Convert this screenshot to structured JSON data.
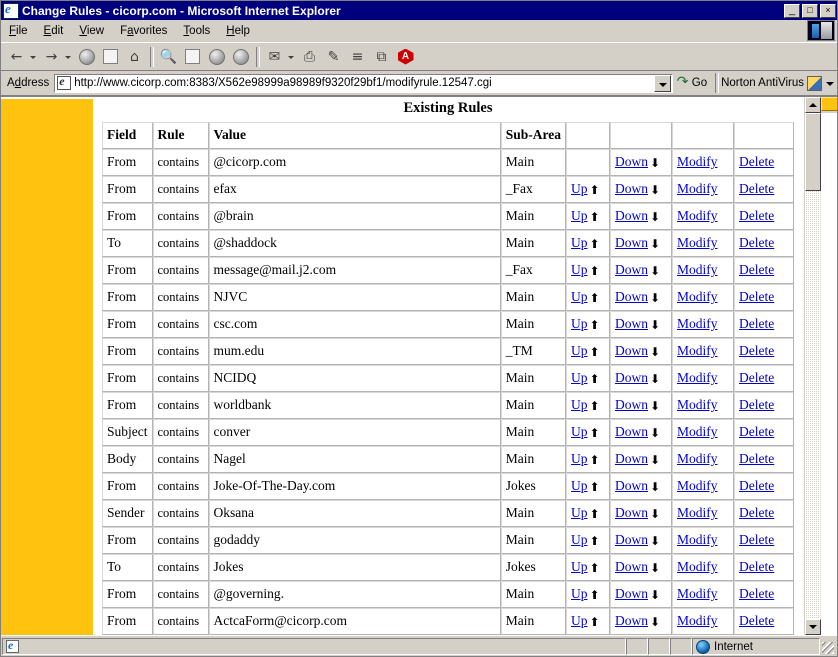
{
  "window": {
    "title": "Change Rules - cicorp.com - Microsoft Internet Explorer",
    "minimize_label": "_",
    "maximize_label": "□",
    "close_label": "×"
  },
  "menu": {
    "items": [
      {
        "label": "File",
        "accel": "F",
        "rest": "ile"
      },
      {
        "label": "Edit",
        "accel": "E",
        "rest": "dit"
      },
      {
        "label": "View",
        "accel": "V",
        "rest": "iew"
      },
      {
        "label": "Favorites",
        "pre": "F",
        "accel": "a",
        "rest": "vorites"
      },
      {
        "label": "Tools",
        "accel": "T",
        "rest": "ools"
      },
      {
        "label": "Help",
        "accel": "H",
        "rest": "elp"
      }
    ]
  },
  "toolbar": {
    "buttons": [
      {
        "name": "back-icon",
        "glyph": "⇐"
      },
      {
        "name": "forward-icon",
        "glyph": "⇒"
      },
      {
        "name": "stop-icon",
        "glyph": "✕"
      },
      {
        "name": "refresh-icon",
        "glyph": "↻"
      },
      {
        "name": "home-icon",
        "glyph": "⌂"
      },
      {
        "name": "search-icon",
        "glyph": "⚲"
      },
      {
        "name": "favorites-icon",
        "glyph": "★"
      },
      {
        "name": "media-icon",
        "glyph": "♪"
      },
      {
        "name": "history-icon",
        "glyph": "◴"
      },
      {
        "name": "mail-icon",
        "glyph": "✉"
      },
      {
        "name": "print-icon",
        "glyph": "⎙"
      },
      {
        "name": "edit-icon",
        "glyph": "✎"
      },
      {
        "name": "discuss-icon",
        "glyph": "≡"
      },
      {
        "name": "messenger-icon",
        "glyph": "⧉"
      },
      {
        "name": "norton-antivirus-icon",
        "glyph": "A"
      }
    ]
  },
  "address": {
    "label": "Address",
    "url": "http://www.cicorp.com:8383/X562e98999a98989f9320f29bf1/modifyrule.12547.cgi",
    "go_label": "Go",
    "antivirus_label": "Norton AntiVirus"
  },
  "page": {
    "title": "Existing Rules",
    "columns": [
      "Field",
      "Rule",
      "Value",
      "Sub-Area",
      "",
      "",
      "",
      ""
    ],
    "actions": {
      "up": "Up",
      "down": "Down",
      "modify": "Modify",
      "delete": "Delete",
      "up_arrow": "⬆",
      "down_arrow": "⬇"
    },
    "rows": [
      {
        "field": "From",
        "rule": "contains",
        "value": "@cicorp.com",
        "subarea": "Main",
        "up": false,
        "down": true
      },
      {
        "field": "From",
        "rule": "contains",
        "value": "efax",
        "subarea": "_Fax",
        "up": true,
        "down": true
      },
      {
        "field": "From",
        "rule": "contains",
        "value": "@brain",
        "subarea": "Main",
        "up": true,
        "down": true
      },
      {
        "field": "To",
        "rule": "contains",
        "value": "@shaddock",
        "subarea": "Main",
        "up": true,
        "down": true
      },
      {
        "field": "From",
        "rule": "contains",
        "value": "message@mail.j2.com",
        "subarea": "_Fax",
        "up": true,
        "down": true
      },
      {
        "field": "From",
        "rule": "contains",
        "value": "NJVC",
        "subarea": "Main",
        "up": true,
        "down": true
      },
      {
        "field": "From",
        "rule": "contains",
        "value": "csc.com",
        "subarea": "Main",
        "up": true,
        "down": true
      },
      {
        "field": "From",
        "rule": "contains",
        "value": "mum.edu",
        "subarea": "_TM",
        "up": true,
        "down": true
      },
      {
        "field": "From",
        "rule": "contains",
        "value": "NCIDQ",
        "subarea": "Main",
        "up": true,
        "down": true
      },
      {
        "field": "From",
        "rule": "contains",
        "value": "worldbank",
        "subarea": "Main",
        "up": true,
        "down": true
      },
      {
        "field": "Subject",
        "rule": "contains",
        "value": "conver",
        "subarea": "Main",
        "up": true,
        "down": true
      },
      {
        "field": "Body",
        "rule": "contains",
        "value": "Nagel",
        "subarea": "Main",
        "up": true,
        "down": true
      },
      {
        "field": "From",
        "rule": "contains",
        "value": "Joke-Of-The-Day.com",
        "subarea": "Jokes",
        "up": true,
        "down": true
      },
      {
        "field": "Sender",
        "rule": "contains",
        "value": "Oksana",
        "subarea": "Main",
        "up": true,
        "down": true
      },
      {
        "field": "From",
        "rule": "contains",
        "value": "godaddy",
        "subarea": "Main",
        "up": true,
        "down": true
      },
      {
        "field": "To",
        "rule": "contains",
        "value": "Jokes",
        "subarea": "Jokes",
        "up": true,
        "down": true
      },
      {
        "field": "From",
        "rule": "contains",
        "value": "@governing.",
        "subarea": "Main",
        "up": true,
        "down": true
      },
      {
        "field": "From",
        "rule": "contains",
        "value": "ActcaForm@cicorp.com",
        "subarea": "Main",
        "up": true,
        "down": true
      }
    ]
  },
  "statusbar": {
    "message": "",
    "zone": "Internet"
  },
  "colors": {
    "titlebar": "#00007F",
    "sidebar": "#FFC20E",
    "link": "#0000CC",
    "chrome": "#D4D0C8"
  }
}
